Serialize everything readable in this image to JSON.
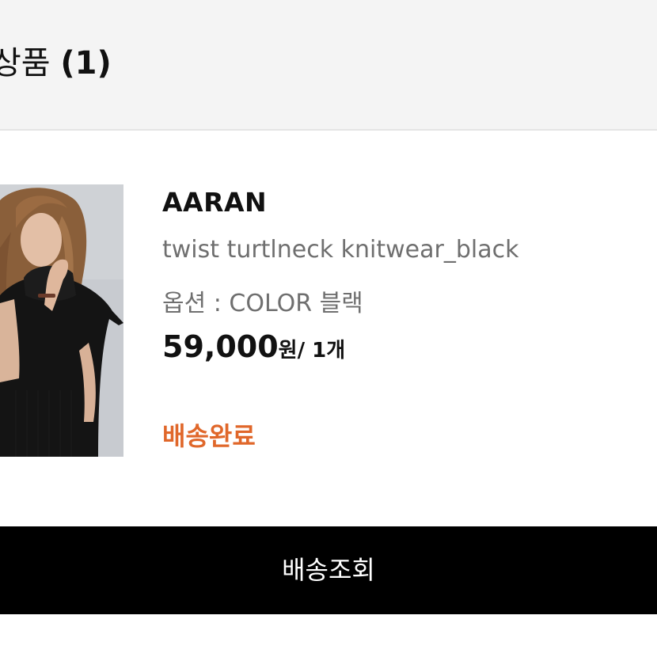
{
  "section": {
    "title": "상품",
    "count": "(1)"
  },
  "product": {
    "brand": "AARAN",
    "name": "twist turtlneck knitwear_black",
    "option": "옵션 : COLOR 블랙",
    "price": "59,000",
    "price_unit": "원",
    "quantity": "/ 1개",
    "status": "배송완료",
    "status_color": "#e0672a"
  },
  "actions": {
    "track_label": "배송조회"
  },
  "colors": {
    "header_bg": "#f4f4f4",
    "button_bg": "#000000",
    "button_text": "#ffffff"
  }
}
